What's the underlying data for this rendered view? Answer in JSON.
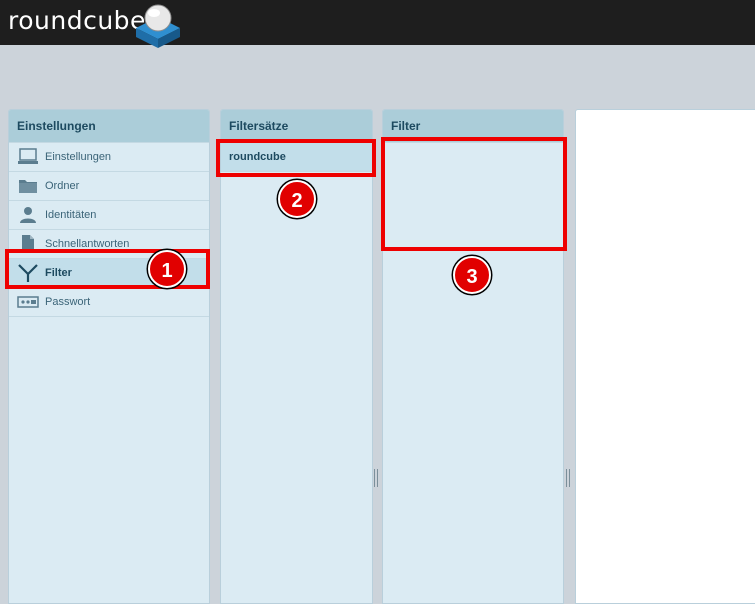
{
  "app": {
    "logo_text": "roundcube"
  },
  "settings": {
    "header": "Einstellungen",
    "items": [
      {
        "label": "Einstellungen",
        "icon": "laptop-icon"
      },
      {
        "label": "Ordner",
        "icon": "folder-icon"
      },
      {
        "label": "Identitäten",
        "icon": "person-icon"
      },
      {
        "label": "Schnellantworten",
        "icon": "document-icon"
      },
      {
        "label": "Filter",
        "icon": "filter-icon",
        "selected": true
      },
      {
        "label": "Passwort",
        "icon": "password-icon"
      }
    ]
  },
  "filtersets": {
    "header": "Filtersätze",
    "items": [
      {
        "label": "roundcube",
        "selected": true
      }
    ]
  },
  "filters": {
    "header": "Filter",
    "items": []
  },
  "annotations": [
    {
      "number": "1",
      "target": "settings-item-filter"
    },
    {
      "number": "2",
      "target": "filterset-roundcube"
    },
    {
      "number": "3",
      "target": "filters-list"
    }
  ],
  "colors": {
    "topbar": "#1e1e1e",
    "panel_bg": "#dbebf3",
    "panel_header": "#abcdd9",
    "selected_row": "#c2deea",
    "annotation_red": "#ee0000"
  }
}
